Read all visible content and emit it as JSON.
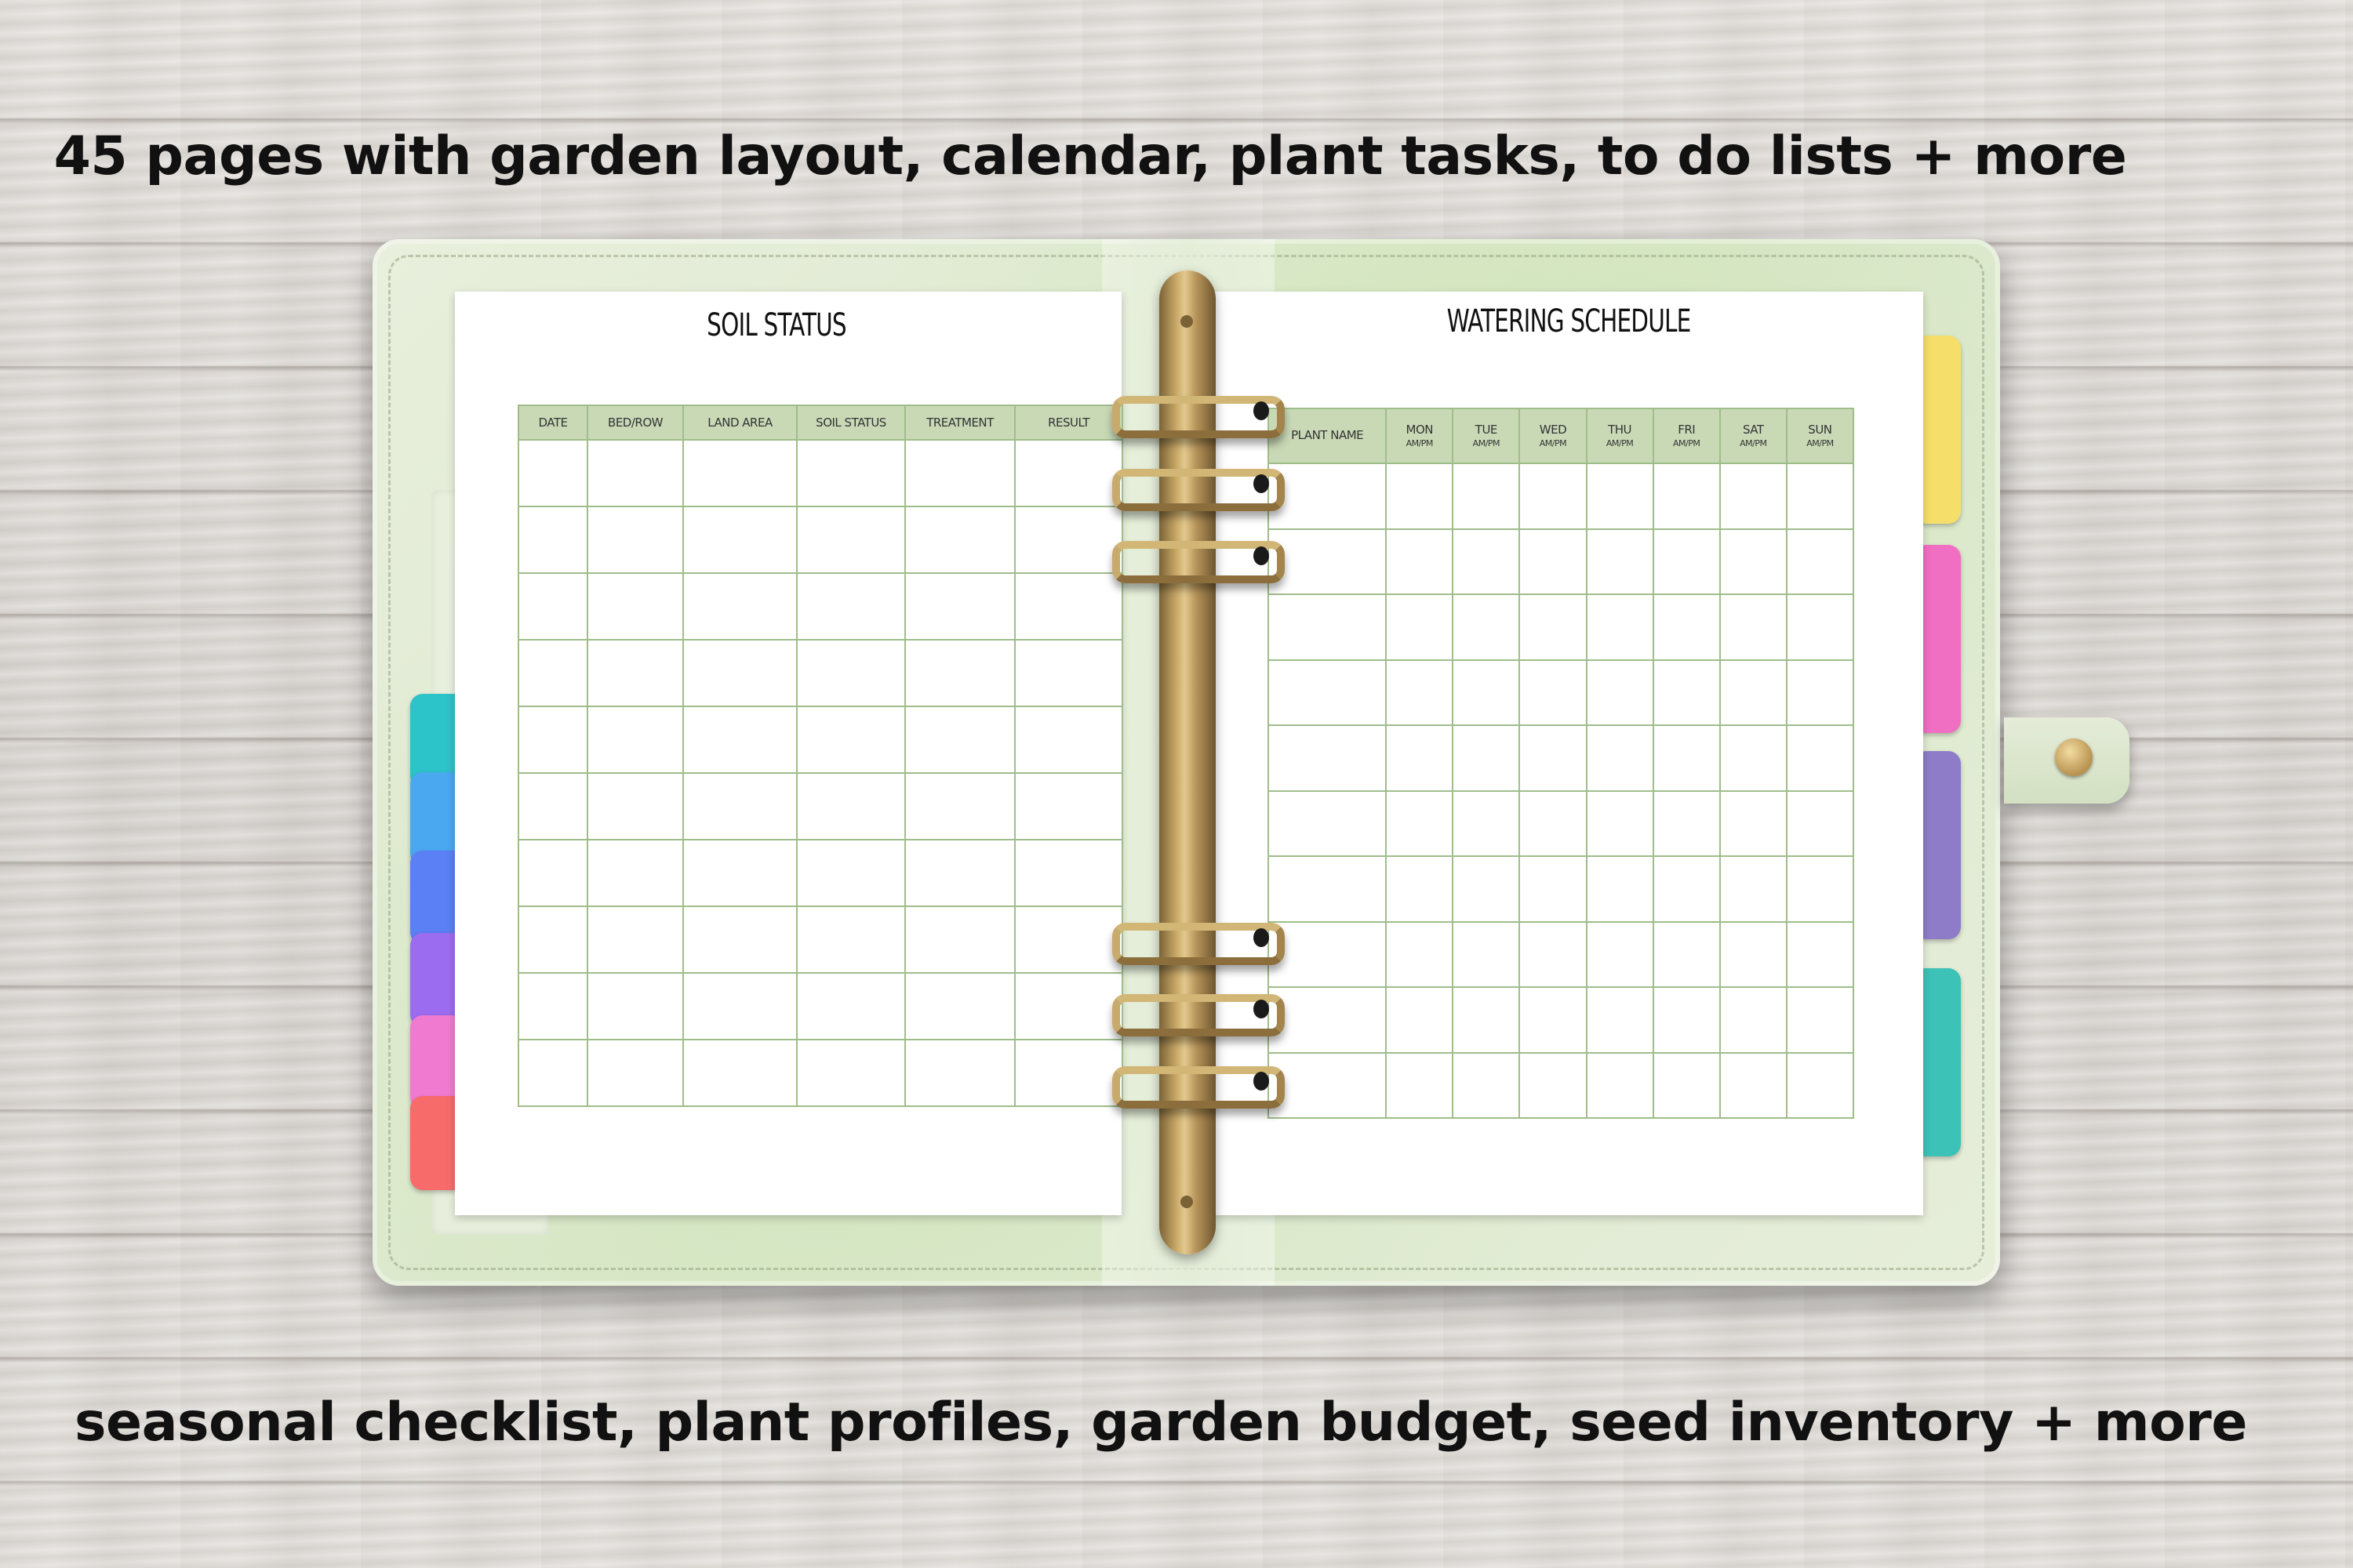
{
  "headline_top": "45 pages with garden layout, calendar, plant tasks, to do lists + more",
  "headline_bottom": "seasonal checklist, plant profiles, garden budget, seed inventory + more",
  "left_page": {
    "title": "SOIL STATUS",
    "columns": [
      "DATE",
      "BED/ROW",
      "LAND AREA",
      "SOIL STATUS",
      "TREATMENT",
      "RESULT"
    ]
  },
  "right_page": {
    "title": "WATERING SCHEDULE",
    "first_column": "PLANT NAME",
    "days": [
      "MON",
      "TUE",
      "WED",
      "THU",
      "FRI",
      "SAT",
      "SUN"
    ],
    "day_sub": "AM/PM"
  },
  "colors": {
    "header_fill": "#c9d9b6",
    "grid_line": "#9fbd8a",
    "binder": "#dbe8cc",
    "left_tabs": [
      "#2cc3c9",
      "#4aa8f0",
      "#5b7ff5",
      "#9b6cf0",
      "#f07ad0",
      "#f76b6b"
    ],
    "right_tabs": [
      "#f5df6a",
      "#f06fc3",
      "#8e7cc9",
      "#3cc2b6"
    ]
  }
}
